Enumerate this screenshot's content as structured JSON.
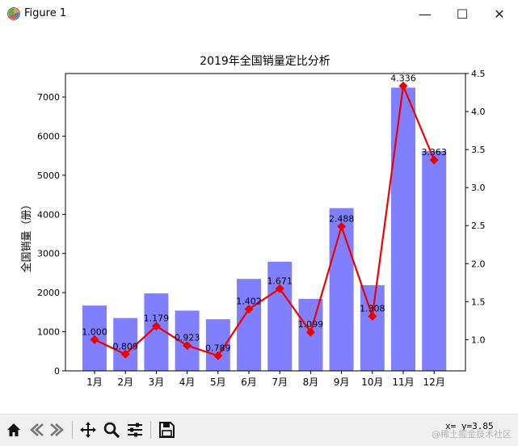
{
  "window": {
    "title": "Figure 1",
    "minimize_label": "—",
    "maximize_label": "☐",
    "close_label": "✕"
  },
  "toolbar": {
    "buttons": [
      "home-icon",
      "back-icon",
      "forward-icon",
      "pan-icon",
      "zoom-icon",
      "configure-subplots-icon",
      "save-icon"
    ],
    "coords": "x=  y=3.85"
  },
  "watermark": "@稀土掘金技术社区",
  "chart_data": {
    "type": "bar",
    "title": "2019年全国销量定比分析",
    "ylabel": "全国销量（册）",
    "categories": [
      "1月",
      "2月",
      "3月",
      "4月",
      "5月",
      "6月",
      "7月",
      "8月",
      "9月",
      "10月",
      "11月",
      "12月"
    ],
    "series": [
      {
        "type": "bar",
        "axis": "left",
        "color": "#8080ff",
        "values": [
          1670,
          1350,
          1980,
          1540,
          1320,
          2350,
          2790,
          1840,
          4160,
          2190,
          7240,
          5620
        ]
      },
      {
        "type": "line",
        "axis": "right",
        "color": "#ee0000",
        "marker": "diamond",
        "values": [
          1.0,
          0.809,
          1.179,
          0.923,
          0.789,
          1.402,
          1.671,
          1.099,
          2.488,
          1.308,
          4.336,
          3.363
        ],
        "labels": [
          "1.000",
          "0.809",
          "1.179",
          "0.923",
          "0.789",
          "1.402",
          "1.671",
          "1.099",
          "2.488",
          "1.308",
          "4.336",
          "3.363"
        ]
      }
    ],
    "ylim_left": [
      0,
      7600
    ],
    "yticks_left": [
      0,
      1000,
      2000,
      3000,
      4000,
      5000,
      6000,
      7000
    ],
    "ylim_right": [
      0.59,
      4.5
    ],
    "yticks_right": [
      1.0,
      1.5,
      2.0,
      2.5,
      3.0,
      3.5,
      4.0,
      4.5
    ],
    "yticklabels_right": [
      "1.0",
      "1.5",
      "2.0",
      "2.5",
      "3.0",
      "3.5",
      "4.0",
      "4.5"
    ],
    "grid": false,
    "legend": "none"
  }
}
